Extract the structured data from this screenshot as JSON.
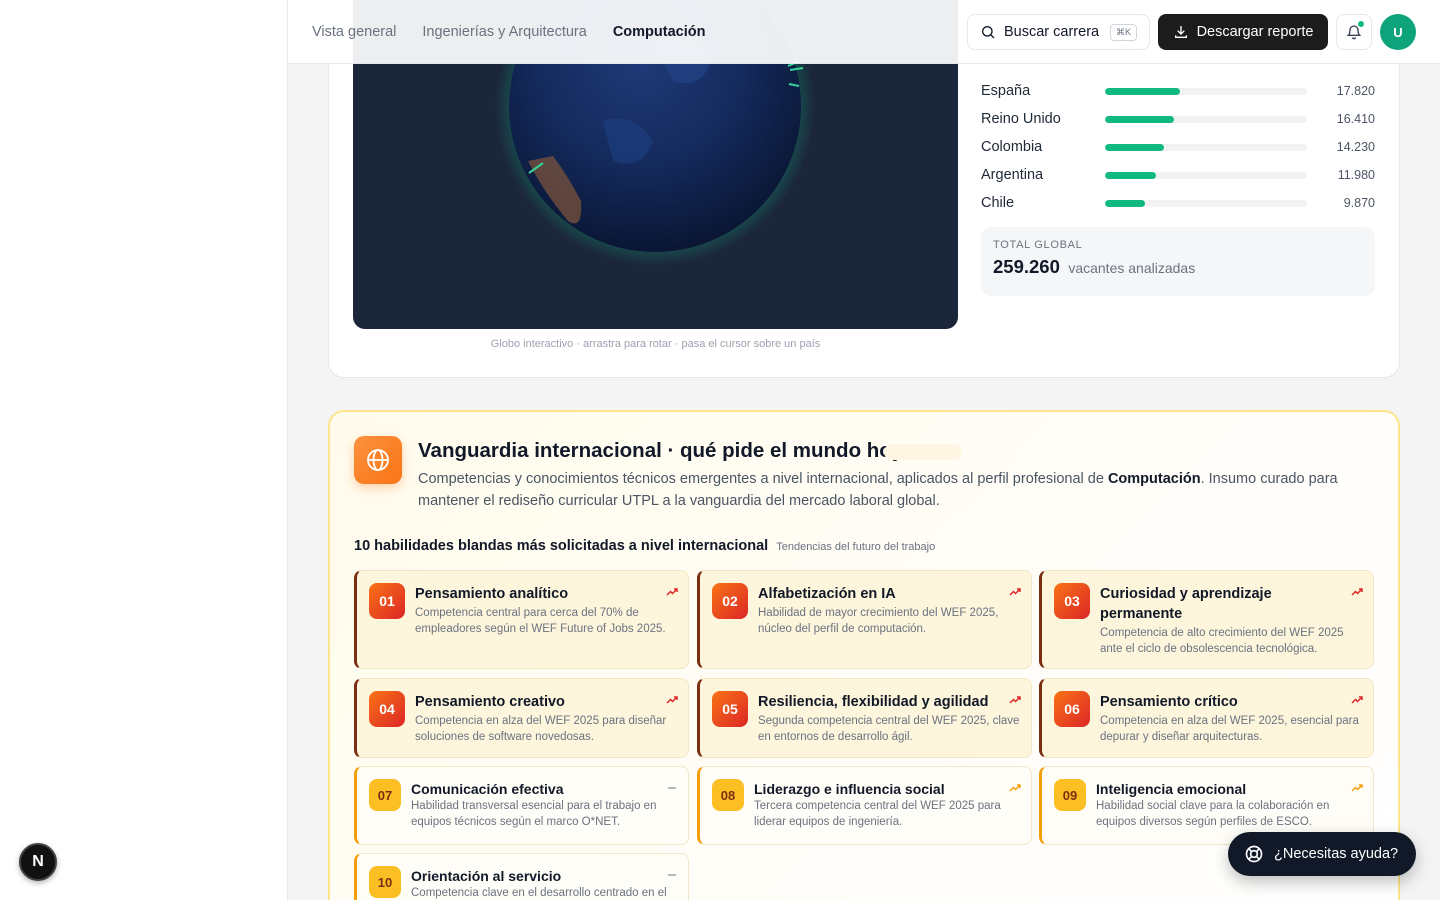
{
  "nav": {
    "tabs": [
      "Vista general",
      "Ingenierías y Arquitectura",
      "Computación"
    ],
    "search_label": "Buscar carrera",
    "search_kbd": "⌘K",
    "download_label": "Descargar reporte",
    "avatar_initial": "U"
  },
  "globe": {
    "caption": "Globo interactivo · arrastra para rotar · pasa el cursor sobre un país",
    "countries": [
      {
        "name": "España",
        "value": "17.820",
        "share": 0.37
      },
      {
        "name": "Reino Unido",
        "value": "16.410",
        "share": 0.34
      },
      {
        "name": "Colombia",
        "value": "14.230",
        "share": 0.29
      },
      {
        "name": "Argentina",
        "value": "11.980",
        "share": 0.25
      },
      {
        "name": "Chile",
        "value": "9.870",
        "share": 0.2
      }
    ],
    "total_label": "TOTAL GLOBAL",
    "total_value": "259.260",
    "total_unit": "vacantes analizadas"
  },
  "vanguard": {
    "title": "Vanguardia internacional · qué pide el mundo hoy",
    "desc_before": "Competencias y conocimientos técnicos emergentes a nivel internacional, aplicados al perfil profesional de ",
    "desc_strong": "Computación",
    "desc_after": ". Insumo curado para mantener el rediseño curricular UTPL a la vanguardia del mercado laboral global.",
    "section_title": "10 habilidades blandas más solicitadas a nivel internacional",
    "section_sub": "Tendencias del futuro del trabajo",
    "skills": [
      {
        "num": "01",
        "title": "Pensamiento analítico",
        "desc": "Competencia central para cerca del 70% de empleadores según el WEF Future of Jobs 2025.",
        "trend": "up"
      },
      {
        "num": "02",
        "title": "Alfabetización en IA",
        "desc": "Habilidad de mayor crecimiento del WEF 2025, núcleo del perfil de computación.",
        "trend": "up"
      },
      {
        "num": "03",
        "title": "Curiosidad y aprendizaje permanente",
        "desc": "Competencia de alto crecimiento del WEF 2025 ante el ciclo de obsolescencia tecnológica.",
        "trend": "up"
      },
      {
        "num": "04",
        "title": "Pensamiento creativo",
        "desc": "Competencia en alza del WEF 2025 para diseñar soluciones de software novedosas.",
        "trend": "up"
      },
      {
        "num": "05",
        "title": "Resiliencia, flexibilidad y agilidad",
        "desc": "Segunda competencia central del WEF 2025, clave en entornos de desarrollo ágil.",
        "trend": "up"
      },
      {
        "num": "06",
        "title": "Pensamiento crítico",
        "desc": "Competencia en alza del WEF 2025, esencial para depurar y diseñar arquitecturas.",
        "trend": "up"
      },
      {
        "num": "07",
        "title": "Comunicación efectiva",
        "desc": "Habilidad transversal esencial para el trabajo en equipos técnicos según el marco O*NET.",
        "trend": "flat"
      },
      {
        "num": "08",
        "title": "Liderazgo e influencia social",
        "desc": "Tercera competencia central del WEF 2025 para liderar equipos de ingeniería.",
        "trend": "up"
      },
      {
        "num": "09",
        "title": "Inteligencia emocional",
        "desc": "Habilidad social clave para la colaboración en equipos diversos según perfiles de ESCO.",
        "trend": "up"
      },
      {
        "num": "10",
        "title": "Orientación al servicio",
        "desc": "Competencia clave en el desarrollo centrado en el",
        "trend": "flat"
      }
    ]
  },
  "help_label": "¿Necesitas ayuda?",
  "next_badge": "N"
}
